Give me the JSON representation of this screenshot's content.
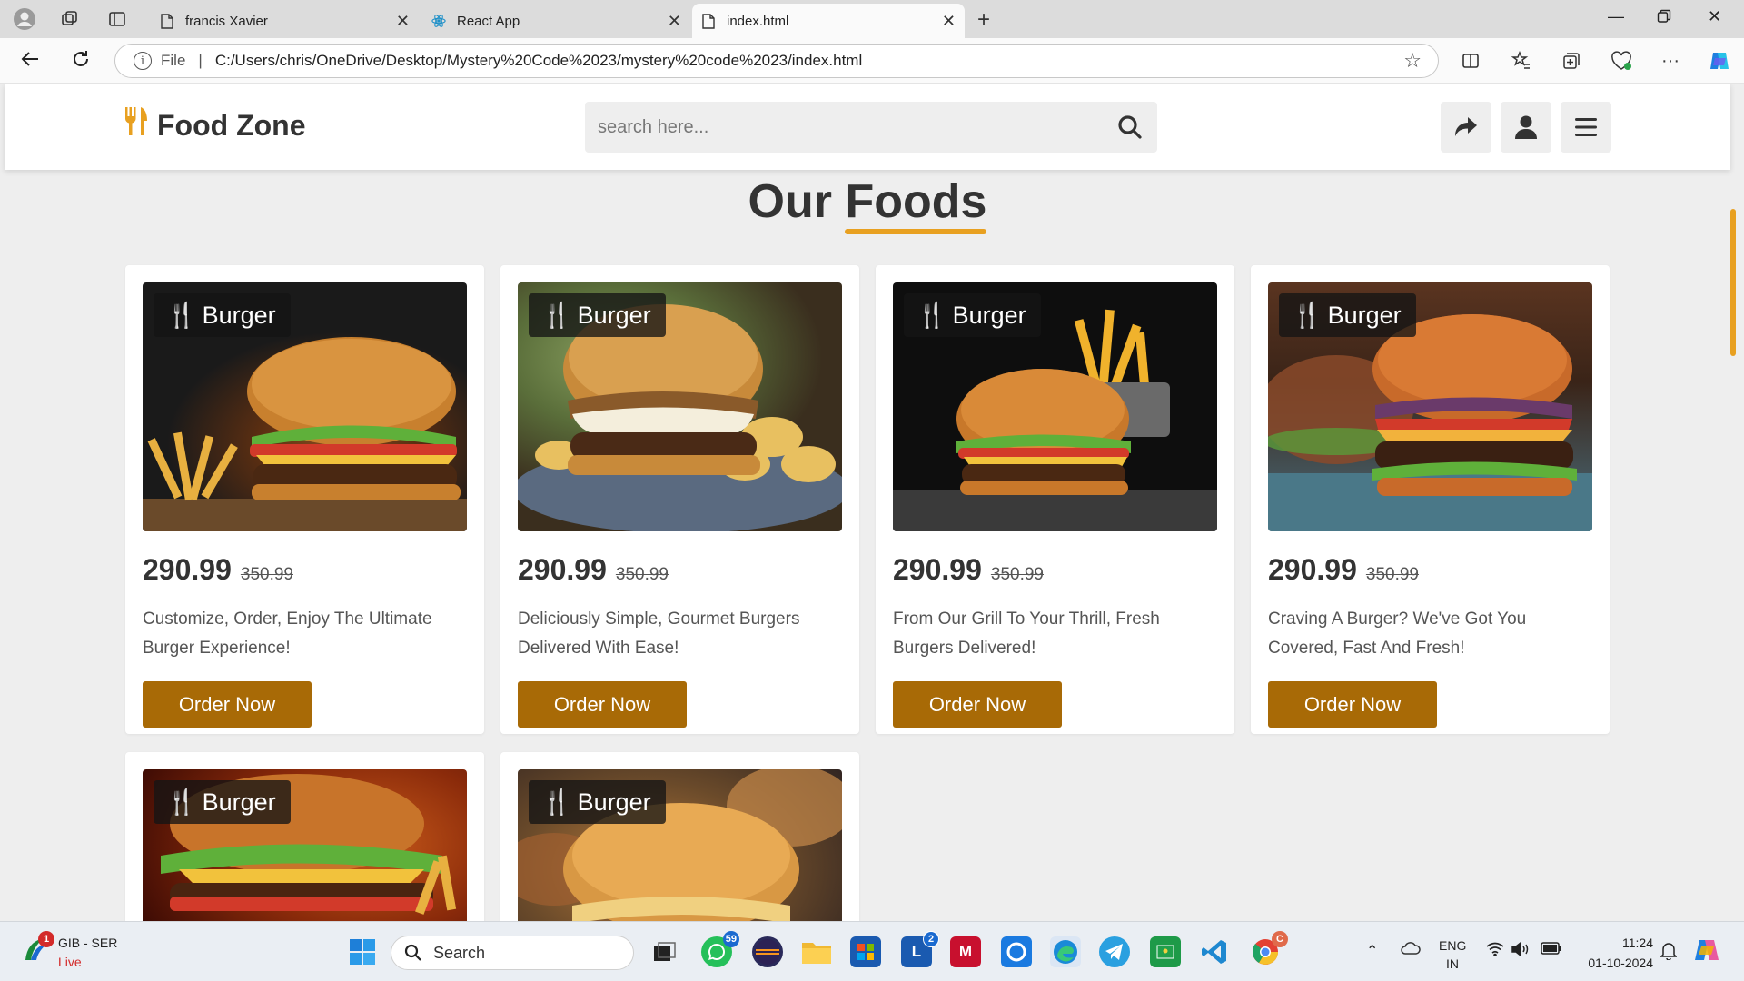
{
  "browser": {
    "tabs": [
      {
        "title": "francis Xavier",
        "active": false
      },
      {
        "title": "React App",
        "active": false
      },
      {
        "title": "index.html",
        "active": true
      }
    ],
    "address": {
      "scheme_label": "File",
      "url": "C:/Users/chris/OneDrive/Desktop/Mystery%20Code%2023/mystery%20code%2023/index.html"
    }
  },
  "site": {
    "logo_text": "Food Zone",
    "search_placeholder": "search here...",
    "heading_plain": "Our ",
    "heading_accent": "Foods",
    "accent_color": "#e8a020",
    "button_color": "#a86a06"
  },
  "foods": [
    {
      "tag": "Burger",
      "price": "290.99",
      "old_price": "350.99",
      "desc": "Customize, Order, Enjoy The Ultimate Burger Experience!",
      "button": "Order Now"
    },
    {
      "tag": "Burger",
      "price": "290.99",
      "old_price": "350.99",
      "desc": "Deliciously Simple, Gourmet Burgers Delivered With Ease!",
      "button": "Order Now"
    },
    {
      "tag": "Burger",
      "price": "290.99",
      "old_price": "350.99",
      "desc": "From Our Grill To Your Thrill, Fresh Burgers Delivered!",
      "button": "Order Now"
    },
    {
      "tag": "Burger",
      "price": "290.99",
      "old_price": "350.99",
      "desc": "Craving A Burger? We've Got You Covered, Fast And Fresh!",
      "button": "Order Now"
    },
    {
      "tag": "Burger"
    },
    {
      "tag": "Burger"
    }
  ],
  "taskbar": {
    "weather_title": "GIB - SER",
    "weather_sub": "Live",
    "weather_badge": "1",
    "search_label": "Search",
    "whatsapp_badge": "59",
    "l_badge": "2",
    "chrome_badge": "C",
    "lang_top": "ENG",
    "lang_bottom": "IN",
    "time": "11:24",
    "date": "01-10-2024"
  }
}
